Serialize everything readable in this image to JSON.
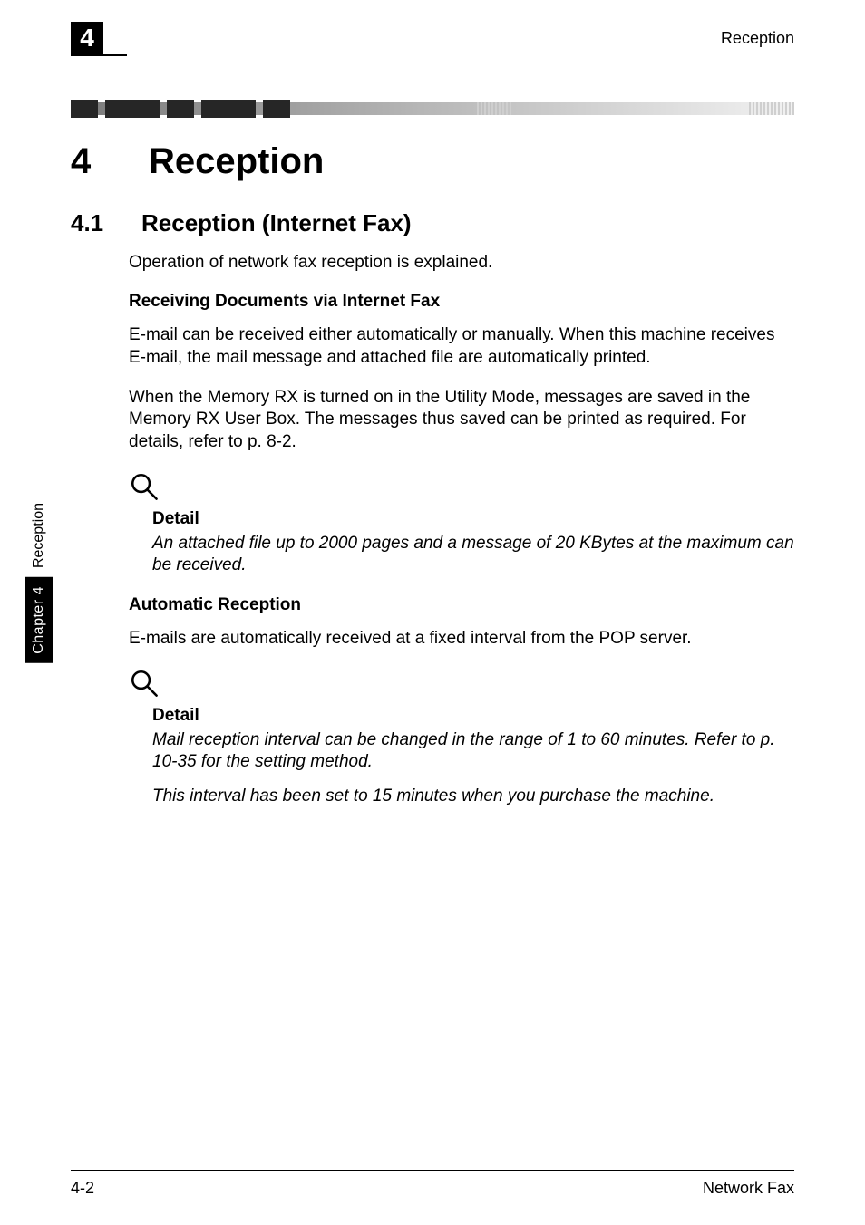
{
  "header": {
    "chapter_number": "4",
    "section_name": "Reception"
  },
  "side_tab": {
    "chapter_label": "Chapter 4",
    "section_label": "Reception"
  },
  "title": {
    "number": "4",
    "text": "Reception"
  },
  "section": {
    "number": "4.1",
    "text": "Reception (Internet Fax)"
  },
  "intro_paragraph": "Operation of network fax reception is explained.",
  "sub1": {
    "heading": "Receiving Documents via Internet Fax",
    "p1": "E-mail can be received either automatically or manually. When this machine receives E-mail, the mail message and attached file are automatically printed.",
    "p2": "When the Memory RX is turned on in the Utility Mode, messages are saved in the Memory RX User Box. The messages thus saved can be printed as required. For details, refer to p. 8-2."
  },
  "detail1": {
    "label": "Detail",
    "text": "An attached file up to 2000 pages and a message of 20 KBytes at the maximum can be received."
  },
  "sub2": {
    "heading": "Automatic Reception",
    "p1": "E-mails are automatically received at a fixed interval from the POP server."
  },
  "detail2": {
    "label": "Detail",
    "text1": "Mail reception interval can be changed in the range of 1 to 60 minutes. Refer to p. 10-35 for the setting method.",
    "text2": "This interval has been set to 15 minutes when you purchase the machine."
  },
  "footer": {
    "left": "4-2",
    "right": "Network Fax"
  }
}
